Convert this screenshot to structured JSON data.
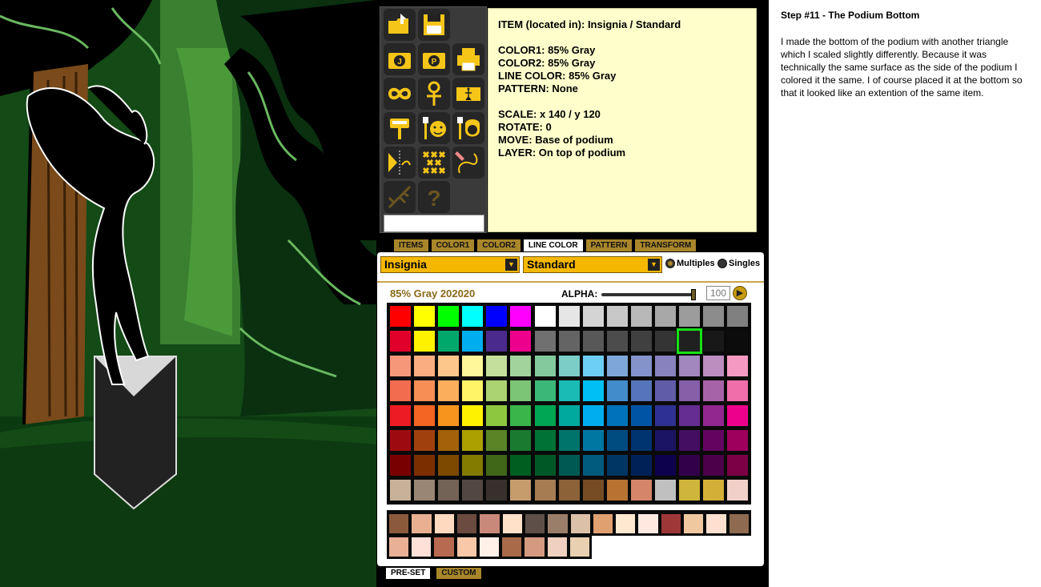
{
  "instructions": {
    "title": "Step #11 - The Podium Bottom",
    "body": "I made the bottom of the podium with another triangle which I scaled slightly differently. Because it was technically the same surface as the side of the podium I colored it the same. I of course placed it at the bottom so that it looked like an extention of the same item."
  },
  "info": {
    "item": "ITEM (located in): Insignia / Standard",
    "color1": "COLOR1: 85% Gray",
    "color2": "COLOR2: 85% Gray",
    "line_color": "LINE COLOR: 85% Gray",
    "pattern": "PATTERN: None",
    "scale": "SCALE: x 140 / y 120",
    "rotate": "ROTATE: 0",
    "move": "MOVE: Base of podium",
    "layer": "LAYER: On top of podium"
  },
  "tools": [
    {
      "name": "open-folder-icon"
    },
    {
      "name": "save-disk-icon"
    },
    {
      "name": "empty-slot"
    },
    {
      "name": "jpeg-camera-icon"
    },
    {
      "name": "png-camera-icon"
    },
    {
      "name": "printer-icon"
    },
    {
      "name": "infinity-icon"
    },
    {
      "name": "ankh-figure-icon"
    },
    {
      "name": "figure-card-icon"
    },
    {
      "name": "paint-roller-icon"
    },
    {
      "name": "face-brush-icon"
    },
    {
      "name": "hair-brush-icon"
    },
    {
      "name": "flip-icon"
    },
    {
      "name": "grid-x-icon"
    },
    {
      "name": "pencil-curve-icon"
    },
    {
      "name": "tree-branch-icon"
    },
    {
      "name": "help-question-icon"
    },
    {
      "name": "empty-slot"
    }
  ],
  "tabs": [
    "ITEMS",
    "COLOR1",
    "COLOR2",
    "LINE COLOR",
    "PATTERN",
    "TRANSFORM"
  ],
  "active_tab": "LINE COLOR",
  "dropdowns": {
    "category": "Insignia",
    "style": "Standard"
  },
  "radio": {
    "multiples": "Multiples",
    "singles": "Singles",
    "selected": "Multiples"
  },
  "color_name": "85% Gray 202020",
  "alpha": {
    "label": "ALPHA:",
    "value": "100",
    "level": 1.0
  },
  "swatches": [
    [
      "#ff0000",
      "#ffff00",
      "#00ff00",
      "#00ffff",
      "#0000ff",
      "#ff00ff",
      "#ffffff",
      "#e6e6e6",
      "#d4d4d4",
      "#c8c8c8",
      "#b8b8b8",
      "#a8a8a8",
      "#9c9c9c",
      "#8c8c8c",
      "#808080"
    ],
    [
      "#e0002a",
      "#fff200",
      "#00a86b",
      "#00aeef",
      "#4b2a8e",
      "#ec008c",
      "#707070",
      "#646464",
      "#585858",
      "#4c4c4c",
      "#404040",
      "#343434",
      "#202020",
      "#181818",
      "#0c0c0c"
    ],
    [
      "#f7977a",
      "#f9ad81",
      "#fdc68a",
      "#fff79a",
      "#c4df9b",
      "#a3d39c",
      "#82ca9d",
      "#7bcdc8",
      "#6ecff6",
      "#7ea7d8",
      "#8493ca",
      "#8882be",
      "#a187be",
      "#bc8dbf",
      "#f49ac2"
    ],
    [
      "#f26c4f",
      "#f68e55",
      "#fbaf5c",
      "#fff467",
      "#acd372",
      "#7cc576",
      "#3bb878",
      "#1abbb4",
      "#00bff3",
      "#438ccb",
      "#5574b9",
      "#605ca8",
      "#855fa8",
      "#a763a8",
      "#f06eaa"
    ],
    [
      "#ed1c24",
      "#f26522",
      "#f7941d",
      "#fff200",
      "#8dc73f",
      "#39b54a",
      "#00a651",
      "#00a99d",
      "#00aeef",
      "#0072bc",
      "#0054a6",
      "#2e3192",
      "#662d91",
      "#92278f",
      "#ec008c"
    ],
    [
      "#9e0b0f",
      "#a0410d",
      "#a36209",
      "#aba000",
      "#598527",
      "#1a7b30",
      "#007236",
      "#00746b",
      "#0076a3",
      "#004b80",
      "#003471",
      "#1b1464",
      "#440e62",
      "#630460",
      "#9e005d"
    ],
    [
      "#790000",
      "#7b2e00",
      "#7d4900",
      "#827b00",
      "#406618",
      "#005e20",
      "#005826",
      "#005952",
      "#005b7f",
      "#003663",
      "#002157",
      "#0d004c",
      "#32004b",
      "#4b0049",
      "#7b0046"
    ],
    [
      "#c7b299",
      "#998675",
      "#736357",
      "#534741",
      "#37302d",
      "#c69c6d",
      "#a67c52",
      "#8c6239",
      "#754c24",
      "#b87333",
      "#d4856a",
      "#c0c0c0",
      "#cfb53b",
      "#d4af37",
      "#f0d0c8"
    ]
  ],
  "selected_swatch": [
    1,
    12
  ],
  "preset_swatches": [
    [
      "#8b5a3c",
      "#e8b090",
      "#ffd8c0",
      "#6b4a40",
      "#c8887a",
      "#ffe0c8",
      "#5e5048",
      "#9a7e6a",
      "#dcc0a8",
      "#e0a070",
      "#ffe8d0",
      "#ffe8e0",
      "#9e3838",
      "#f0c8a0",
      "#ffe0d0",
      "#8e6a50"
    ],
    [
      "#e8b094",
      "#ffe0d8",
      "#b86a50",
      "#f8c8a8",
      "#fff0e8",
      "#a86a48",
      "#d49a80",
      "#f0d0c0",
      "#e8d0b0"
    ]
  ],
  "bottom_tabs": [
    "PRE-SET",
    "CUSTOM"
  ],
  "active_bottom_tab": "PRE-SET"
}
